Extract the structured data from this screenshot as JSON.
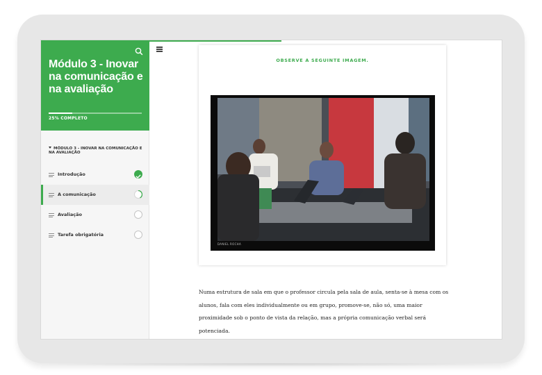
{
  "sidebar": {
    "course_title": "Módulo 3 - Inovar na comunicação e na avaliação",
    "progress_percent": 25,
    "progress_label": "25% COMPLETO",
    "section_title": "MÓDULO 3 - INOVAR NA COMUNICAÇÃO E NA AVALIAÇÃO",
    "lessons": [
      {
        "label": "Introdução",
        "status": "complete"
      },
      {
        "label": "A comunicação",
        "status": "in-progress"
      },
      {
        "label": "Avaliação",
        "status": "not-started"
      },
      {
        "label": "Tarefa obrigatória",
        "status": "not-started"
      }
    ],
    "accent_color": "#3dab4e"
  },
  "main": {
    "observe_label": "OBSERVE A SEGUINTE IMAGEM.",
    "photo_credit": "DANIEL ROCHA",
    "paragraph": "Numa estrutura de sala em que o professor circula pela sala de aula, senta-se à mesa com os alunos, fala com eles individualmente ou em grupo, promove-se, não só, uma maior proximidade sob o ponto de vista da relação, mas a própria comunicação verbal será potenciada."
  }
}
